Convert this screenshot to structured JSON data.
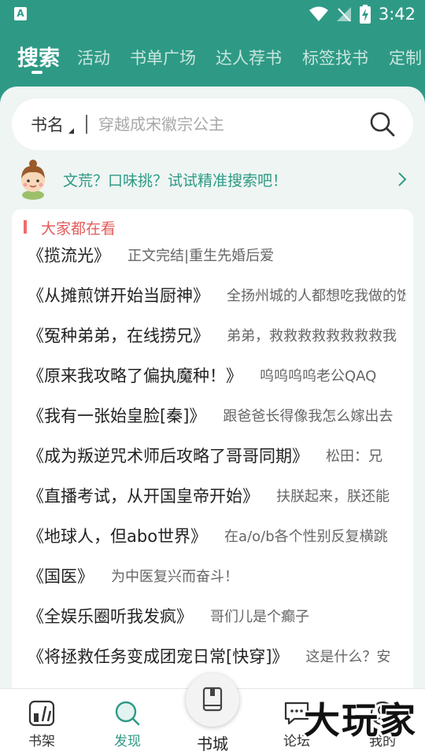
{
  "status_bar": {
    "app_badge": "A",
    "time": "3:42"
  },
  "top_tabs": [
    {
      "label": "搜索",
      "active": true
    },
    {
      "label": "活动"
    },
    {
      "label": "书单广场"
    },
    {
      "label": "达人荐书"
    },
    {
      "label": "标签找书"
    },
    {
      "label": "定制"
    }
  ],
  "search": {
    "type_label": "书名",
    "placeholder": "穿越成宋徽宗公主"
  },
  "promo": {
    "text": "文荒？口味挑？试试精准搜索吧！"
  },
  "section": {
    "title": "大家都在看"
  },
  "books": [
    {
      "title": "《揽流光》",
      "desc": "正文完结|重生先婚后爱"
    },
    {
      "title": "《从摊煎饼开始当厨神》",
      "desc": "全扬州城的人都想吃我做的饭"
    },
    {
      "title": "《冤种弟弟，在线捞兄》",
      "desc": "弟弟，救救救救救救救救我"
    },
    {
      "title": "《原来我攻略了偏执魔种！》",
      "desc": "呜呜呜呜老公QAQ"
    },
    {
      "title": "《我有一张始皇脸[秦]》",
      "desc": "跟爸爸长得像我怎么嫁出去"
    },
    {
      "title": "《成为叛逆咒术师后攻略了哥哥同期》",
      "desc": "松田：兄"
    },
    {
      "title": "《直播考试，从开国皇帝开始》",
      "desc": "扶朕起来，朕还能"
    },
    {
      "title": "《地球人，但abo世界》",
      "desc": "在a/o/b各个性别反复横跳"
    },
    {
      "title": "《国医》",
      "desc": "为中医复兴而奋斗！"
    },
    {
      "title": "《全娱乐圈听我发疯》",
      "desc": "哥们儿是个癫子"
    },
    {
      "title": "《将拯救任务变成团宠日常[快穿]》",
      "desc": "这是什么？安"
    }
  ],
  "bottom_nav": {
    "shelf": "书架",
    "discover": "发现",
    "city": "书城",
    "forum": "论坛",
    "mine": "我的"
  },
  "watermark": "大玩家",
  "colors": {
    "primary": "#2e9a85",
    "accent_red": "#e55b5b",
    "panel_bg": "#eef5f3"
  }
}
